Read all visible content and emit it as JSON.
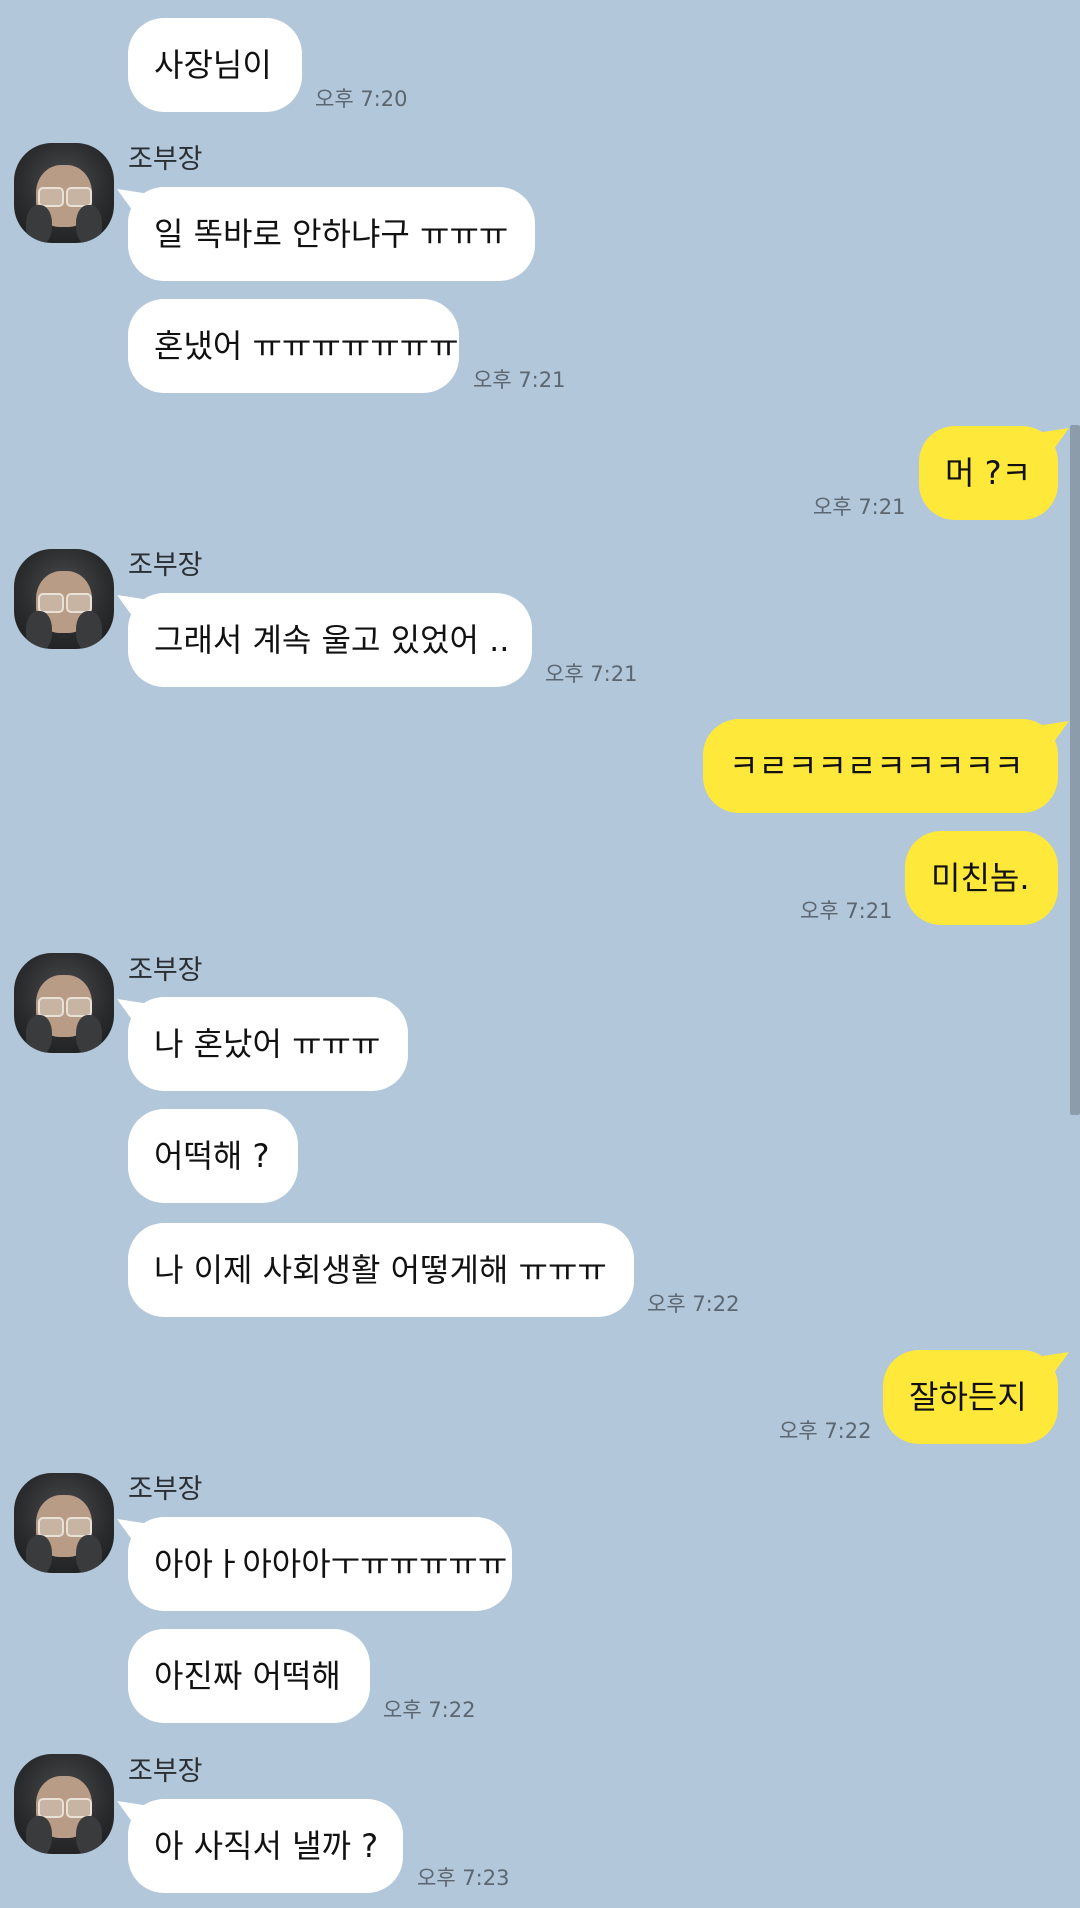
{
  "contact_name": "조부장",
  "messages": {
    "m1": {
      "text": "사장님이",
      "time": "오후 7:20"
    },
    "m2": {
      "text": "일 똑바로 안하냐구 ㅠㅠㅠ"
    },
    "m3": {
      "text": "혼냈어 ㅠㅠㅠㅠㅠㅠㅠ",
      "time": "오후 7:21"
    },
    "m4": {
      "text": "머 ?ㅋ",
      "time": "오후 7:21"
    },
    "m5": {
      "text": "그래서 계속 울고 있었어 ..",
      "time": "오후 7:21"
    },
    "m6": {
      "text": "ㅋㄹㅋㅋㄹㅋㅋㅋㅋㅋ"
    },
    "m7": {
      "text": "미친놈.",
      "time": "오후 7:21"
    },
    "m8": {
      "text": "나 혼났어 ㅠㅠㅠ"
    },
    "m9": {
      "text": "어떡해 ?"
    },
    "m10": {
      "text": "나 이제 사회생활 어떻게해 ㅠㅠㅠ",
      "time": "오후 7:22"
    },
    "m11": {
      "text": "잘하든지",
      "time": "오후 7:22"
    },
    "m12": {
      "text": "아아ㅏ아아아ㅜㅠㅠㅠㅠㅠ"
    },
    "m13": {
      "text": "아진짜 어떡해",
      "time": "오후 7:22"
    },
    "m14": {
      "text": "아 사직서 낼까 ?",
      "time": "오후 7:23"
    }
  },
  "colors": {
    "background": "#b2c7da",
    "incoming_bubble": "#ffffff",
    "outgoing_bubble": "#fee83a"
  },
  "icons": {
    "avatar": "profile-photo"
  }
}
